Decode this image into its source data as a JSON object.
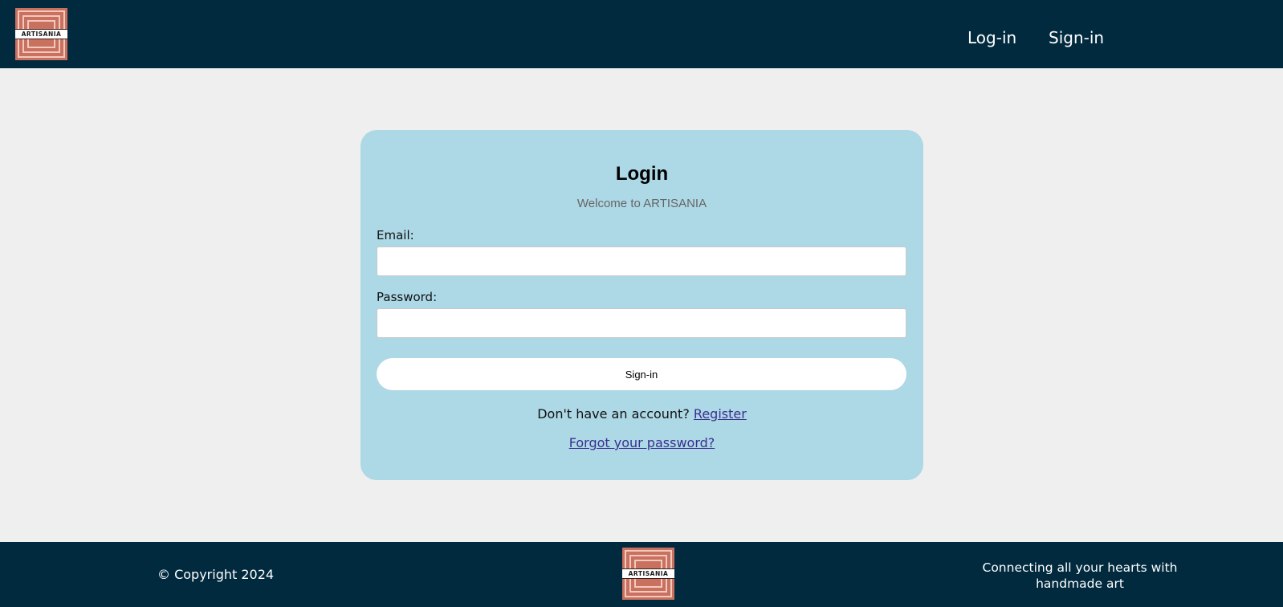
{
  "header": {
    "logo_text": "ARTISANIA",
    "nav": {
      "login": "Log-in",
      "signin": "Sign-in"
    }
  },
  "login_card": {
    "title": "Login",
    "subtitle": "Welcome to ARTISANIA",
    "email_label": "Email:",
    "email_value": "",
    "password_label": "Password:",
    "password_value": "",
    "submit_label": "Sign-in",
    "register_prompt": "Don't have an account?",
    "register_link": "Register",
    "forgot_link": "Forgot your password?"
  },
  "footer": {
    "copyright": "© Copyright 2024",
    "logo_text": "ARTISANIA",
    "tagline": "Connecting all your hearts with handmade art"
  },
  "colors": {
    "header_bg": "#012a3e",
    "card_bg": "#add8e6",
    "page_bg": "#efefef",
    "logo_bg": "#c9705f",
    "link": "#3b2f8f"
  }
}
